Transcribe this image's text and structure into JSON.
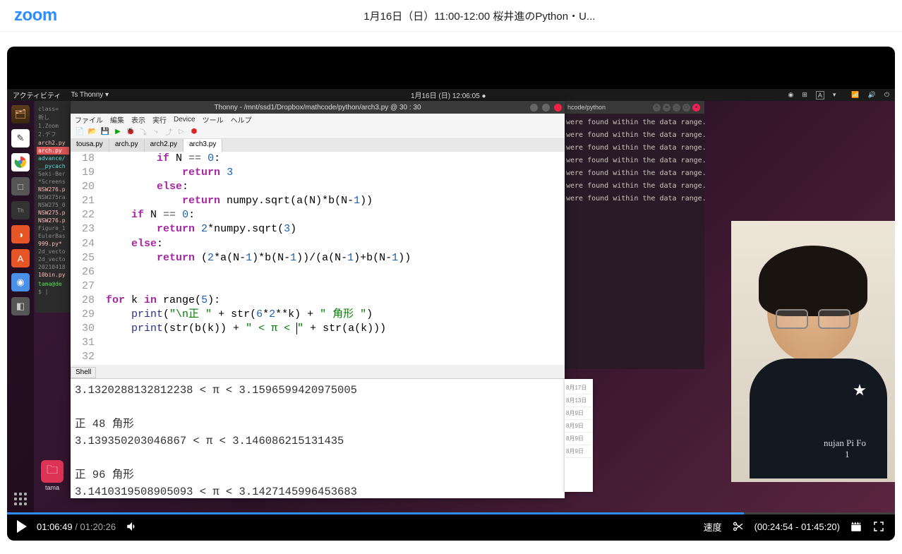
{
  "zoom": {
    "logo": "zoom",
    "title": "1月16日（日）11:00-12:00 桜井進のPython・U..."
  },
  "ubuntu": {
    "activities": "アクティビティ",
    "app_indicator": "Ts Thonny ▾",
    "datetime": "1月16日 (日)  12:06:05 ●",
    "trash_label": "tama"
  },
  "files_sidebar": [
    "class=",
    "新し",
    "1.Zoom",
    "2.デフ",
    "arch2.py",
    "arch.py",
    "advance/",
    "__pycach",
    "Seki-Ber",
    "*Screens",
    "NSW276.p",
    "NSW275ra",
    "NSW275_0",
    "NSW275.p",
    "NSW276.p",
    "Figure_1",
    "EulerBas",
    "999.py*",
    "2d_vecto",
    "2d_vecto",
    "20210418",
    "10bin.py",
    "",
    "tama@de",
    "$ |"
  ],
  "terminal": {
    "title": "hcode/python",
    "lines": [
      "were found within the data range.",
      "",
      "",
      "",
      "were found within the data range.",
      "were found within the data range.",
      "were found within the data range.",
      "",
      "",
      "were found within the data range.",
      "were found within the data range.",
      "were found within the data range."
    ]
  },
  "thonny": {
    "title": "Thonny  -  /mnt/ssd1/Dropbox/mathcode/python/arch3.py  @  30 : 30",
    "menu": [
      "ファイル",
      "編集",
      "表示",
      "実行",
      "Device",
      "ツール",
      "ヘルプ"
    ],
    "tabs": [
      "tousa.py",
      "arch.py",
      "arch2.py",
      "arch3.py"
    ],
    "shell_label": "Shell",
    "code": {
      "start": 18,
      "lines": [
        {
          "n": "18",
          "ind": 8,
          "tokens": [
            {
              "t": "if",
              "c": "kw"
            },
            {
              "t": " N "
            },
            {
              "t": "==",
              "c": "op"
            },
            {
              "t": " "
            },
            {
              "t": "0",
              "c": "num"
            },
            {
              "t": ":"
            }
          ]
        },
        {
          "n": "19",
          "ind": 12,
          "tokens": [
            {
              "t": "return",
              "c": "kw"
            },
            {
              "t": " "
            },
            {
              "t": "3",
              "c": "num"
            }
          ]
        },
        {
          "n": "20",
          "ind": 8,
          "tokens": [
            {
              "t": "else",
              "c": "kw"
            },
            {
              "t": ":"
            }
          ]
        },
        {
          "n": "21",
          "ind": 12,
          "tokens": [
            {
              "t": "return",
              "c": "kw"
            },
            {
              "t": " numpy.sqrt(a(N)*b(N-"
            },
            {
              "t": "1",
              "c": "num"
            },
            {
              "t": "))"
            }
          ]
        },
        {
          "n": "22",
          "ind": 4,
          "tokens": [
            {
              "t": "if",
              "c": "kw"
            },
            {
              "t": " N "
            },
            {
              "t": "==",
              "c": "op"
            },
            {
              "t": " "
            },
            {
              "t": "0",
              "c": "num"
            },
            {
              "t": ":"
            }
          ]
        },
        {
          "n": "23",
          "ind": 8,
          "tokens": [
            {
              "t": "return",
              "c": "kw"
            },
            {
              "t": " "
            },
            {
              "t": "2",
              "c": "num"
            },
            {
              "t": "*numpy.sqrt("
            },
            {
              "t": "3",
              "c": "num"
            },
            {
              "t": ")"
            }
          ]
        },
        {
          "n": "24",
          "ind": 4,
          "tokens": [
            {
              "t": "else",
              "c": "kw"
            },
            {
              "t": ":"
            }
          ]
        },
        {
          "n": "25",
          "ind": 8,
          "tokens": [
            {
              "t": "return",
              "c": "kw"
            },
            {
              "t": " ("
            },
            {
              "t": "2",
              "c": "num"
            },
            {
              "t": "*a(N-"
            },
            {
              "t": "1",
              "c": "num"
            },
            {
              "t": ")*b(N-"
            },
            {
              "t": "1",
              "c": "num"
            },
            {
              "t": "))/(a(N-"
            },
            {
              "t": "1",
              "c": "num"
            },
            {
              "t": ")+b(N-"
            },
            {
              "t": "1",
              "c": "num"
            },
            {
              "t": "))"
            }
          ]
        },
        {
          "n": "26",
          "ind": 0,
          "tokens": []
        },
        {
          "n": "27",
          "ind": 0,
          "tokens": []
        },
        {
          "n": "28",
          "ind": 0,
          "tokens": [
            {
              "t": "for",
              "c": "kw"
            },
            {
              "t": " k "
            },
            {
              "t": "in",
              "c": "kw"
            },
            {
              "t": " range("
            },
            {
              "t": "5",
              "c": "num"
            },
            {
              "t": "):"
            }
          ]
        },
        {
          "n": "29",
          "ind": 4,
          "tokens": [
            {
              "t": "print",
              "c": "fn"
            },
            {
              "t": "("
            },
            {
              "t": "\"\\n正 \"",
              "c": "str"
            },
            {
              "t": " + str("
            },
            {
              "t": "6",
              "c": "num"
            },
            {
              "t": "*"
            },
            {
              "t": "2",
              "c": "num"
            },
            {
              "t": "**k) + "
            },
            {
              "t": "\" 角形 \"",
              "c": "str"
            },
            {
              "t": ")"
            }
          ]
        },
        {
          "n": "30",
          "ind": 4,
          "tokens": [
            {
              "t": "print",
              "c": "fn"
            },
            {
              "t": "(str(b(k)) + "
            },
            {
              "t": "\" < π < \"",
              "c": "str",
              "cursor": true
            },
            {
              "t": " + str(a(k)))"
            }
          ]
        },
        {
          "n": "31",
          "ind": 0,
          "tokens": []
        },
        {
          "n": "32",
          "ind": 0,
          "tokens": []
        }
      ]
    },
    "shell_output": [
      "3.1320288132812238 < π < 3.1596599420975005",
      "",
      "正 48 角形",
      "3.139350203046867 < π < 3.146086215131435",
      "",
      "正 96 角形",
      "3.1410319508905093 < π < 3.1427145996453683"
    ],
    "shell_prompt": ">>>"
  },
  "notes": [
    "8月17日",
    "8月13日",
    "8月9日",
    "8月9日",
    "8月9日",
    "8月9日"
  ],
  "webcam": {
    "tshirt": "nujan Pi Fo",
    "tshirt2": "1"
  },
  "player": {
    "current": "01:06:49",
    "total": "01:20:26",
    "progress_pct": 83,
    "speed_label": "速度",
    "clip_range": "(00:24:54 - 01:45:20)"
  }
}
